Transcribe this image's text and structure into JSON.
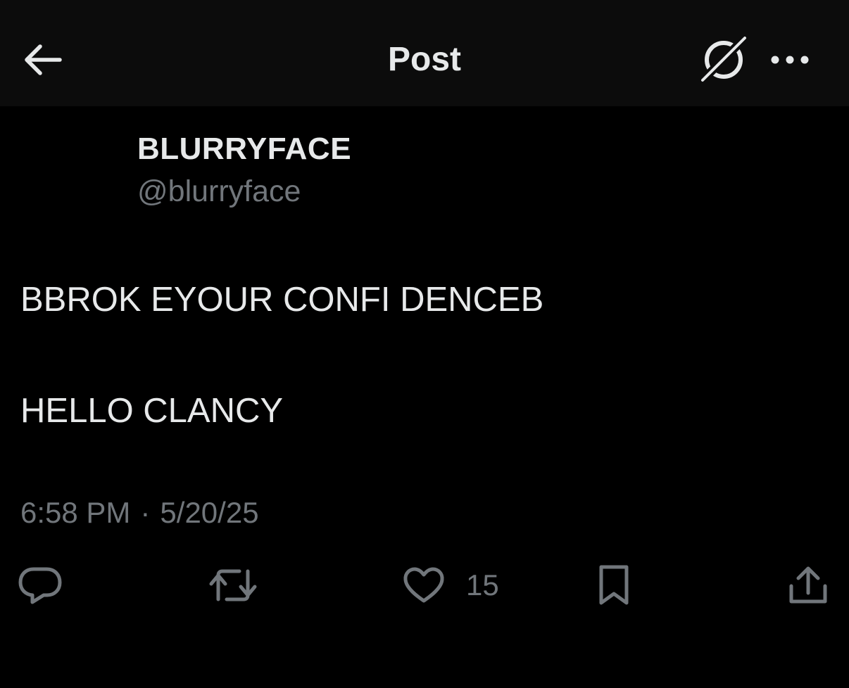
{
  "header": {
    "title": "Post",
    "icons": [
      "back-arrow-icon",
      "grok-icon",
      "more-icon"
    ]
  },
  "author": {
    "name": "BLURRYFACE",
    "handle": "@blurryface"
  },
  "post": {
    "line1": "BBROK EYOUR CONFI DENCEB",
    "line2": "HELLO CLANCY",
    "time": "6:58 PM",
    "separator": "·",
    "date": "5/20/25"
  },
  "actions": {
    "like_count": "15",
    "icons": [
      "reply-icon",
      "repost-icon",
      "like-icon",
      "bookmark-icon",
      "share-icon"
    ]
  },
  "colors": {
    "background": "#000000",
    "header_background": "#0c0c0c",
    "text_primary": "#e7e9ea",
    "text_secondary": "#71767b"
  }
}
